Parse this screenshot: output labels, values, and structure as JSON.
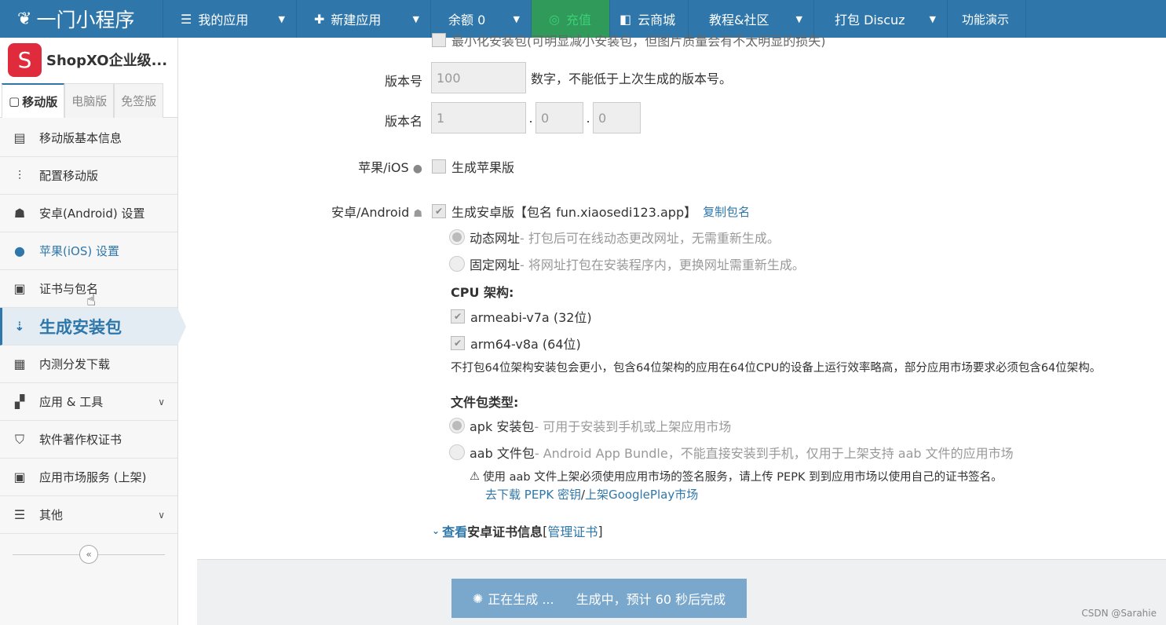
{
  "topbar": {
    "brand": "一门小程序",
    "nav": [
      {
        "icon": "☰",
        "label": "我的应用"
      },
      {
        "icon": "✚",
        "label": "新建应用"
      },
      {
        "label": "余额 0"
      },
      {
        "icon": "◎",
        "label": "充值"
      },
      {
        "icon": "◧",
        "label": "云商城"
      },
      {
        "label": "教程&社区"
      },
      {
        "label": "打包 Discuz"
      },
      {
        "label": "功能演示"
      }
    ]
  },
  "sidebar": {
    "app_logo_letter": "S",
    "app_name": "ShopXO企业级...",
    "tabs": [
      "移动版",
      "电脑版",
      "免签版"
    ],
    "items": [
      {
        "label": "移动版基本信息"
      },
      {
        "label": "配置移动版"
      },
      {
        "label": "安卓(Android) 设置"
      },
      {
        "label": "苹果(iOS) 设置"
      },
      {
        "label": "证书与包名"
      },
      {
        "label": "生成安装包"
      },
      {
        "label": "内测分发下载"
      },
      {
        "label": "应用 & 工具"
      },
      {
        "label": "软件著作权证书"
      },
      {
        "label": "应用市场服务 (上架)"
      },
      {
        "label": "其他"
      }
    ],
    "collapse_icon": "«"
  },
  "form": {
    "top_cut_text": "最小化安装包(可明显减小安装包，但图片质量会有不太明显的损失)",
    "version_code_label": "版本号",
    "version_code_value": "100",
    "version_code_hint": "数字，不能低于上次生成的版本号。",
    "version_name_label": "版本名",
    "version_name_parts": [
      "1",
      "0",
      "0"
    ],
    "ios_label": "苹果/iOS",
    "ios_check": "生成苹果版",
    "android_label": "安卓/Android",
    "android_check": "生成安卓版【包名 fun.xiaosedi123.app】",
    "copy_pkg": "复制包名",
    "url_options": [
      {
        "title": "动态网址",
        "desc": " - 打包后可在线动态更改网址，无需重新生成。"
      },
      {
        "title": "固定网址",
        "desc": " - 将网址打包在安装程序内，更换网址需重新生成。"
      }
    ],
    "cpu_title": "CPU 架构:",
    "cpu_options": [
      "armeabi-v7a (32位)",
      "arm64-v8a (64位)"
    ],
    "cpu_note": "不打包64位架构安装包会更小，包含64位架构的应用在64位CPU的设备上运行效率略高，部分应用市场要求必须包含64位架构。",
    "pkg_title": "文件包类型:",
    "pkg_options": [
      {
        "title": "apk 安装包",
        "desc": " - 可用于安装到手机或上架应用市场"
      },
      {
        "title": "aab 文件包",
        "desc": " - Android App Bundle，不能直接安装到手机，仅用于上架支持 aab 文件的应用市场"
      }
    ],
    "aab_warning": "使用 aab 文件上架必须使用应用市场的签名服务，请上传 PEPK 到到应用市场以使用自己的证书签名。",
    "pepk_link": "去下载 PEPK 密钥",
    "link_sep": " / ",
    "gplay_link": "上架GooglePlay市场",
    "cert_view": "查看",
    "cert_title": " 安卓证书信息 ",
    "cert_manage": "管理证书"
  },
  "footer": {
    "btn_generating": "正在生成 ...",
    "btn_status": "生成中，预计 60 秒后完成"
  },
  "watermark": "CSDN @Sarahie"
}
